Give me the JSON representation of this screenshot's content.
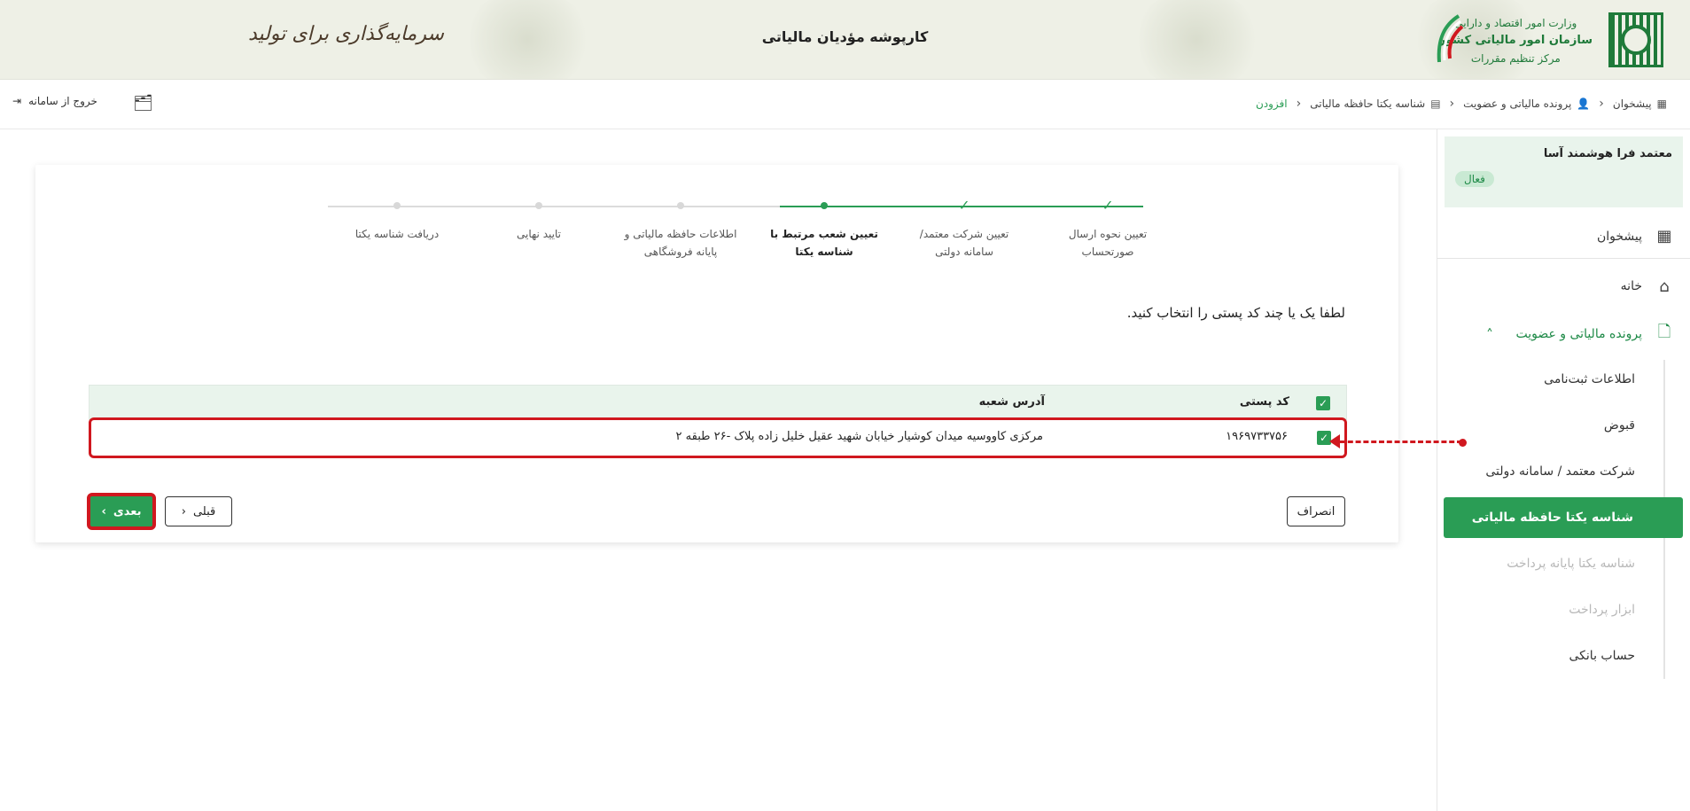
{
  "header": {
    "org_line1": "وزارت امور اقتصاد و دارایی",
    "org_line2": "سازمان امور مالیاتی کشور",
    "org_line3": "مرکز تنظیم مقررات",
    "title": "کارپوشه مؤدیان مالیاتی",
    "slogan": "سرمایه‌گذاری برای تولید"
  },
  "topbar": {
    "breadcrumb": [
      "پیشخوان",
      "پرونده مالیاتی و عضویت",
      "شناسه یکتا حافظه مالیاتی",
      "افزودن"
    ],
    "exit_label": "خروج از سامانه"
  },
  "sidebar": {
    "company_name": "معتمد فرا هوشمند آسا",
    "status": "فعال",
    "items": [
      {
        "label": "پیشخوان",
        "icon": "dashboard-icon"
      },
      {
        "label": "خانه",
        "icon": "home-icon"
      },
      {
        "label": "پرونده مالیاتی و عضویت",
        "icon": "document-icon"
      }
    ],
    "sub_items": [
      {
        "label": "اطلاعات ثبت‌نامی",
        "disabled": false
      },
      {
        "label": "قبوض",
        "disabled": false
      },
      {
        "label": "شرکت معتمد / سامانه دولتی",
        "disabled": false
      },
      {
        "label": "شناسه یکتا حافظه مالیاتی",
        "active": true
      },
      {
        "label": "شناسه یکتا پایانه پرداخت",
        "disabled": true
      },
      {
        "label": "ابزار پرداخت",
        "disabled": true
      },
      {
        "label": "حساب بانکی",
        "disabled": false
      }
    ]
  },
  "stepper": {
    "steps": [
      {
        "label": "تعیین نحوه ارسال صورتحساب",
        "state": "done"
      },
      {
        "label": "تعیین شرکت معتمد/سامانه دولتی",
        "state": "done"
      },
      {
        "label": "تعیین شعب مرتبط با شناسه یکتا",
        "state": "current"
      },
      {
        "label": "اطلاعات حافظه مالیاتی و پایانه فروشگاهی",
        "state": "pending"
      },
      {
        "label": "تایید نهایی",
        "state": "pending"
      },
      {
        "label": "دریافت شناسه یکتا",
        "state": "pending"
      }
    ]
  },
  "main": {
    "instruction": "لطفا یک یا چند کد پستی را انتخاب کنید.",
    "table": {
      "col_postal": "کد پستی",
      "col_address": "آدرس شعبه",
      "rows": [
        {
          "postal": "۱۹۶۹۷۳۳۷۵۶",
          "address": "مرکزی کاووسیه میدان کوشیار خیابان شهید عقیل خلیل زاده پلاک -۲۶ طبقه ۲",
          "checked": true
        }
      ]
    },
    "btn_cancel": "انصراف",
    "btn_prev": "قبلی",
    "btn_next": "بعدی"
  },
  "colors": {
    "primary": "#2a9d55",
    "highlight": "#d0181f"
  }
}
